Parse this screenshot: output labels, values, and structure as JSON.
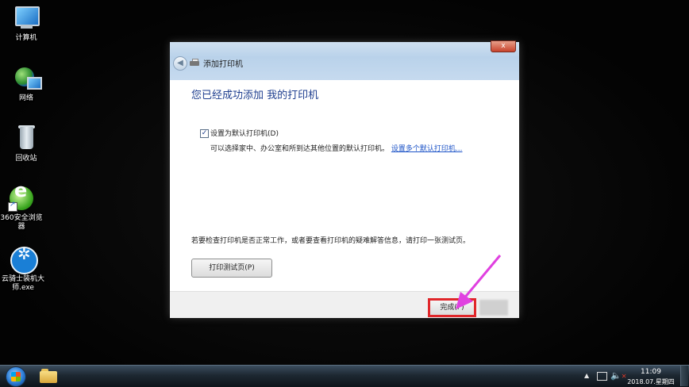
{
  "desktop": {
    "icons": [
      {
        "label": "计算机"
      },
      {
        "label": "网络"
      },
      {
        "label": "回收站"
      },
      {
        "label": "360安全浏览器"
      },
      {
        "label": "云骑士装机大师.exe"
      }
    ]
  },
  "dialog": {
    "title": "添加打印机",
    "close_label": "x",
    "back_label": "◀",
    "heading": "您已经成功添加 我的打印机",
    "default_checkbox_label": "设置为默认打印机(D)",
    "description": "可以选择家中、办公室和所到达其他位置的默认打印机。",
    "link_text": "设置多个默认打印机...",
    "test_hint": "若要检查打印机是否正常工作，或者要查看打印机的疑难解答信息，请打印一张测试页。",
    "test_button": "打印测试页(P)",
    "finish_button": "完成(F)"
  },
  "taskbar": {
    "time": "11:09",
    "date": "2018.07.星期四",
    "tray_arrow": "▲"
  },
  "colors": {
    "heading": "#1e3e8f",
    "link": "#1c53c7",
    "highlight_box": "#e0262a",
    "annotation_arrow": "#e040e0"
  }
}
